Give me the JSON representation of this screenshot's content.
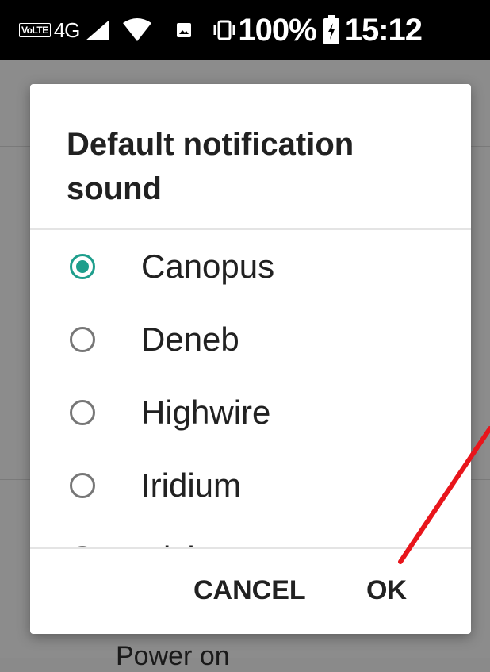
{
  "status_bar": {
    "volte": "VoLTE",
    "network": "4G",
    "battery": "100%",
    "time": "15:12"
  },
  "background": {
    "partial_item": "Power on"
  },
  "dialog": {
    "title": "Default notification sound",
    "options": [
      {
        "label": "Canopus",
        "selected": true
      },
      {
        "label": "Deneb",
        "selected": false
      },
      {
        "label": "Highwire",
        "selected": false
      },
      {
        "label": "Iridium",
        "selected": false
      },
      {
        "label": "Pixie Dust",
        "selected": false
      }
    ],
    "cancel_label": "CANCEL",
    "ok_label": "OK"
  },
  "colors": {
    "accent": "#1e9e8c",
    "annotation": "#e8151b"
  }
}
